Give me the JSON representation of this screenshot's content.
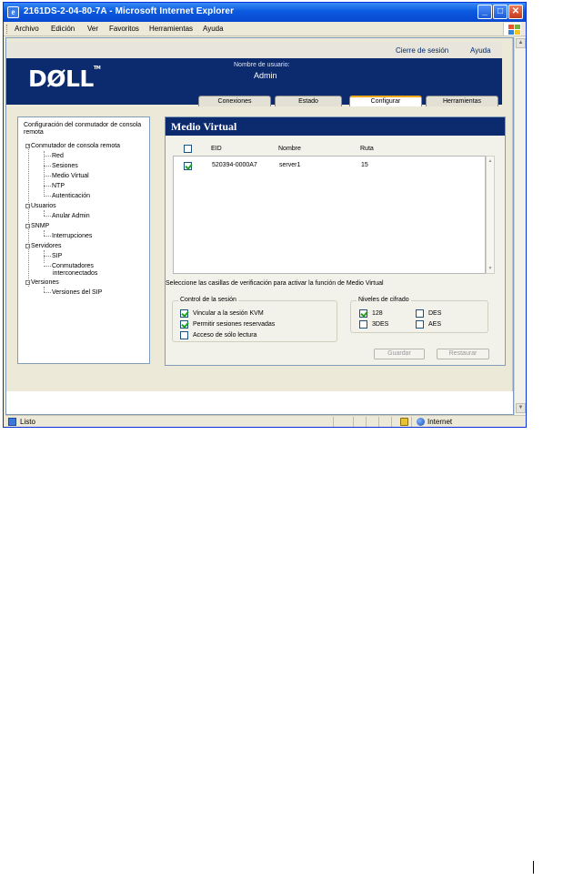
{
  "window": {
    "title": "2161DS-2-04-80-7A - Microsoft Internet Explorer",
    "minimize_glyph": "_",
    "maximize_glyph": "□",
    "close_glyph": "✕"
  },
  "menubar": {
    "items": [
      "Archivo",
      "Edición",
      "Ver",
      "Favoritos",
      "Herramientas",
      "Ayuda"
    ]
  },
  "header": {
    "logout_link": "Cierre de sesión",
    "help_link": "Ayuda",
    "logo_text": "DØLL",
    "user_label": "Nombre de usuario:",
    "user_name": "Admin",
    "tabs": [
      {
        "label": "Conexiones",
        "active": false
      },
      {
        "label": "Estado",
        "active": false
      },
      {
        "label": "Configurar",
        "active": true
      },
      {
        "label": "Herramientas",
        "active": false
      }
    ]
  },
  "nav": {
    "title": "Configuración del conmutador de consola remota",
    "items": [
      {
        "label": "Conmutador de consola remota",
        "level": 0
      },
      {
        "label": "Red",
        "level": 1
      },
      {
        "label": "Sesiones",
        "level": 1
      },
      {
        "label": "Medio Virtual",
        "level": 1
      },
      {
        "label": "NTP",
        "level": 1
      },
      {
        "label": "Autenticación",
        "level": 1
      },
      {
        "label": "Usuarios",
        "level": 0
      },
      {
        "label": "Anular Admin",
        "level": 1
      },
      {
        "label": "SNMP",
        "level": 0
      },
      {
        "label": "Interrupciones",
        "level": 1
      },
      {
        "label": "Servidores",
        "level": 0
      },
      {
        "label": "SIP",
        "level": 1
      },
      {
        "label": "Conmutadores",
        "level": 1
      },
      {
        "label": "interconectados",
        "level": 1
      },
      {
        "label": "Versiones",
        "level": 0
      },
      {
        "label": "Versiones del SIP",
        "level": 1
      }
    ]
  },
  "content": {
    "title": "Medio Virtual",
    "columns": [
      "EID",
      "Nombre",
      "Ruta"
    ],
    "rows": [
      {
        "checked": true,
        "eid": "520394-0000A7",
        "name": "server1",
        "path": "15"
      }
    ],
    "hint": "Seleccione las casillas de verificación para activar la función de Medio Virtual",
    "session_group": {
      "title": "Control de la sesión",
      "options": [
        {
          "label": "Vincular a la sesión KVM",
          "checked": true
        },
        {
          "label": "Permitir sesiones reservadas",
          "checked": true
        },
        {
          "label": "Acceso de sólo lectura",
          "checked": false
        }
      ]
    },
    "encryption_group": {
      "title": "Niveles de cifrado",
      "options": [
        {
          "label": "128",
          "checked": true
        },
        {
          "label": "DES",
          "checked": false
        },
        {
          "label": "3DES",
          "checked": false
        },
        {
          "label": "AES",
          "checked": false
        }
      ]
    },
    "save_label": "Guardar",
    "restore_label": "Restaurar"
  },
  "statusbar": {
    "status": "Listo",
    "zone": "Internet"
  },
  "scroll": {
    "up_glyph": "▲",
    "down_glyph": "▼"
  }
}
